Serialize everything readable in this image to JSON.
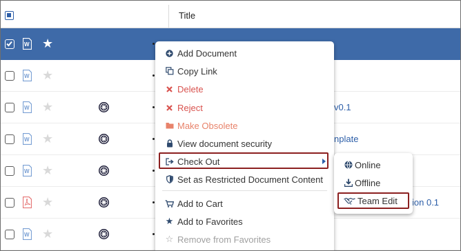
{
  "header": {
    "title_column": "Title"
  },
  "rows": [
    {
      "selected": true,
      "doc_type": "word-icon",
      "has_lock": false,
      "text": ""
    },
    {
      "selected": false,
      "doc_type": "word-icon",
      "has_lock": false,
      "text": ""
    },
    {
      "selected": false,
      "doc_type": "word-icon",
      "has_lock": true,
      "text": "v0.1"
    },
    {
      "selected": false,
      "doc_type": "word-icon",
      "has_lock": true,
      "text": "nplate"
    },
    {
      "selected": false,
      "doc_type": "word-icon",
      "has_lock": true,
      "text": ""
    },
    {
      "selected": false,
      "doc_type": "pdf-icon",
      "has_lock": true,
      "text": "ion 0.1"
    },
    {
      "selected": false,
      "doc_type": "word-icon",
      "has_lock": true,
      "text": ""
    }
  ],
  "context_menu": {
    "items": [
      {
        "label": "Add Document",
        "icon": "plus-circle-icon"
      },
      {
        "label": "Copy Link",
        "icon": "copy-icon"
      },
      {
        "label": "Delete",
        "icon": "x-icon"
      },
      {
        "label": "Reject",
        "icon": "x-icon"
      },
      {
        "label": "Make Obsolete",
        "icon": "folder-icon"
      },
      {
        "label": "View document security",
        "icon": "lock-icon"
      },
      {
        "label": "Check Out",
        "icon": "check-out-icon"
      },
      {
        "label": "Set as Restricted Document Content",
        "icon": "shield-icon"
      },
      {
        "label": "Add to Cart",
        "icon": "cart-icon"
      },
      {
        "label": "Add to Favorites",
        "icon": "star-icon"
      },
      {
        "label": "Remove from Favorites",
        "icon": "star-outline-icon"
      }
    ]
  },
  "submenu": {
    "items": [
      {
        "label": "Online",
        "icon": "globe-icon"
      },
      {
        "label": "Offline",
        "icon": "download-icon"
      },
      {
        "label": "Team Edit",
        "icon": "handshake-icon"
      }
    ]
  },
  "colors": {
    "selected_row": "#3e6aa8",
    "link_blue": "#2c5ea8",
    "danger": "#d9534f",
    "highlight_border": "#8b1f1f"
  }
}
